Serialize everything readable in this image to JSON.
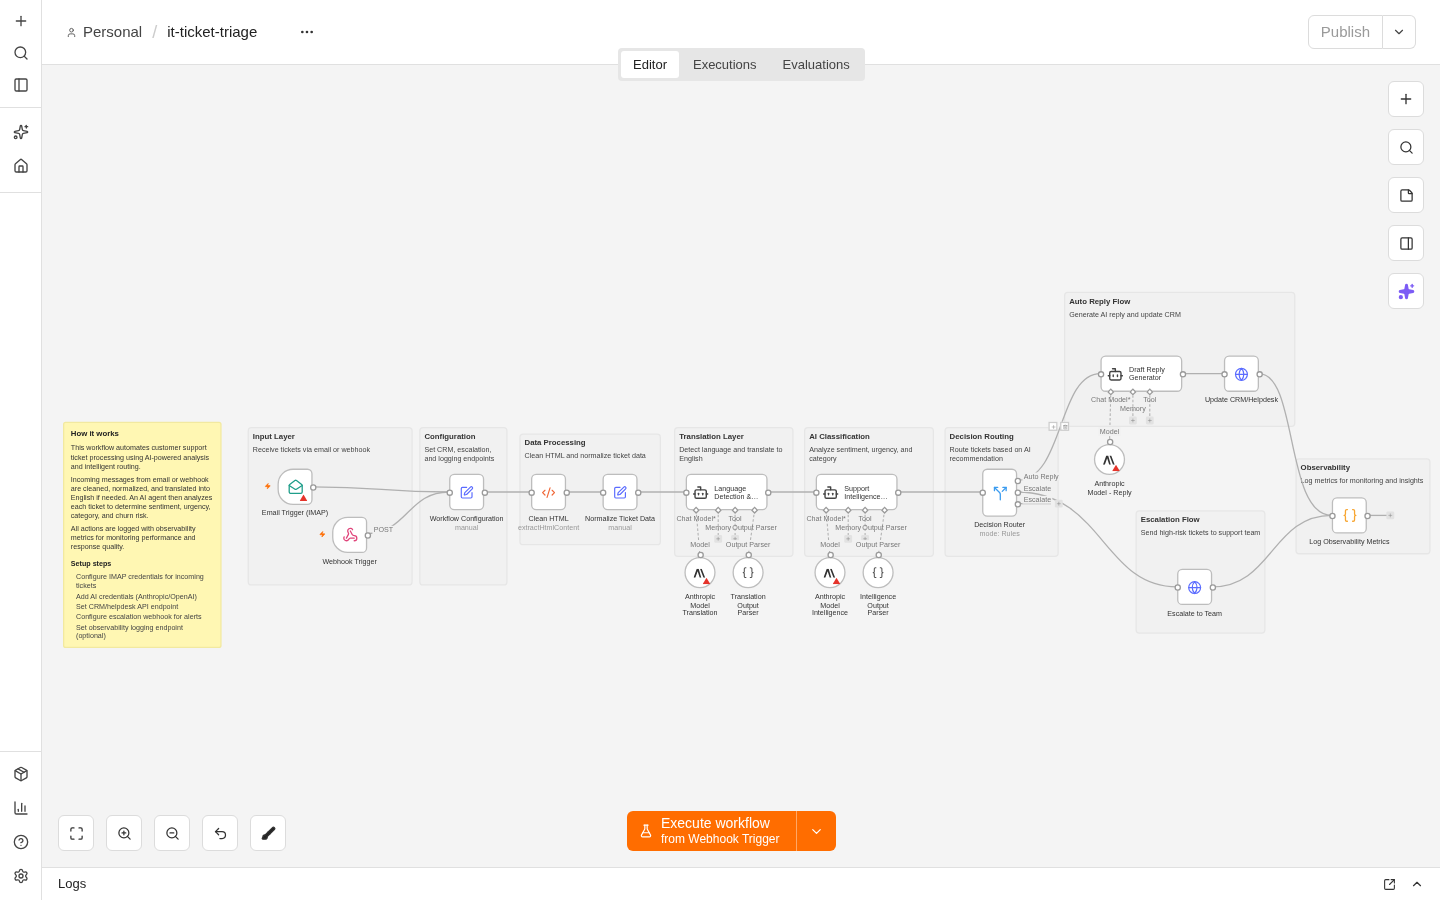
{
  "breadcrumb": {
    "project": "Personal",
    "separator": "/",
    "workflow": "it-ticket-triage"
  },
  "publish": {
    "label": "Publish"
  },
  "tabs": [
    {
      "label": "Editor",
      "selected": true
    },
    {
      "label": "Executions",
      "selected": false
    },
    {
      "label": "Evaluations",
      "selected": false
    }
  ],
  "sticky": {
    "title": "How it works",
    "paragraphs": [
      "This workflow automates customer support ticket processing using AI-powered analysis and intelligent routing.",
      "Incoming messages from email or webhook are cleaned, normalized, and translated into English if needed. An AI agent then analyzes each ticket to determine sentiment, urgency, category, and churn risk.",
      "All actions are logged with observability metrics for monitoring performance and response quality."
    ],
    "setup_title": "Setup steps",
    "steps": [
      "Configure IMAP credentials for incoming tickets",
      "Add AI credentials (Anthropic/OpenAI)",
      "Set CRM/helpdesk API endpoint",
      "Configure escalation webhook for alerts",
      "Set observability logging endpoint (optional)"
    ]
  },
  "groups": [
    {
      "title": "Input Layer",
      "description": "Receive tickets via email or webhook"
    },
    {
      "title": "Configuration",
      "description": "Set CRM, escalation, and logging endpoints"
    },
    {
      "title": "Data Processing",
      "description": "Clean HTML and normalize ticket data"
    },
    {
      "title": "Translation Layer",
      "description": "Detect language and translate to English"
    },
    {
      "title": "AI Classification",
      "description": "Analyze sentiment, urgency, and category"
    },
    {
      "title": "Decision Routing",
      "description": "Route tickets based on AI recommendation"
    },
    {
      "title": "Auto Reply Flow",
      "description": "Generate AI reply and update CRM"
    },
    {
      "title": "Escalation Flow",
      "description": "Send high-risk tickets to support team"
    },
    {
      "title": "Observability",
      "description": "Log metrics for monitoring and insights"
    }
  ],
  "nodes": [
    {
      "kind": "email",
      "label": "Email Trigger (IMAP)",
      "warning": true
    },
    {
      "kind": "webhook",
      "label": "Webhook Trigger",
      "outputs": [
        "POST"
      ],
      "warning": false
    },
    {
      "kind": "set",
      "label": "Workflow Configuration",
      "subtitle": "manual",
      "warning": false
    },
    {
      "kind": "code",
      "label": "Clean HTML",
      "subtitle": "extractHtmlContent",
      "warning": false
    },
    {
      "kind": "set",
      "label": "Normalize Ticket Data",
      "subtitle": "manual",
      "warning": false
    },
    {
      "kind": "agent",
      "label": "Language Detection &…",
      "inputs": [
        "Chat Model*",
        "Memory",
        "Tool",
        "Output Parser"
      ],
      "warning": false
    },
    {
      "kind": "model",
      "label": "Anthropic Model Translation",
      "port": "Model",
      "warning": true
    },
    {
      "kind": "parser",
      "label": "Translation Output Parser",
      "port": "Output Parser",
      "warning": false
    },
    {
      "kind": "agent",
      "label": "Support Intelligence…",
      "inputs": [
        "Chat Model*",
        "Memory",
        "Tool",
        "Output Parser"
      ],
      "warning": false
    },
    {
      "kind": "model",
      "label": "Anthropic Model Intelligence",
      "port": "Model",
      "warning": true
    },
    {
      "kind": "parser",
      "label": "Intelligence Output Parser",
      "port": "Output Parser",
      "warning": false
    },
    {
      "kind": "router",
      "label": "Decision Router",
      "subtitle": "mode: Rules",
      "outputs": [
        "Auto Reply",
        "Escalate",
        "Escalate"
      ],
      "warning": false
    },
    {
      "kind": "agent",
      "label": "Draft Reply Generator",
      "inputs": [
        "Chat Model*",
        "Memory",
        "Tool"
      ],
      "warning": false
    },
    {
      "kind": "model",
      "label": "Anthropic Model - Reply",
      "port": "Model",
      "warning": true
    },
    {
      "kind": "http",
      "label": "Update CRM/Helpdesk",
      "warning": false
    },
    {
      "kind": "http",
      "label": "Escalate to Team",
      "warning": false
    },
    {
      "kind": "json",
      "label": "Log Observability Metrics",
      "warning": false
    }
  ],
  "execute": {
    "label": "Execute workflow",
    "subtitle": "from Webhook Trigger"
  },
  "logs": {
    "label": "Logs"
  }
}
